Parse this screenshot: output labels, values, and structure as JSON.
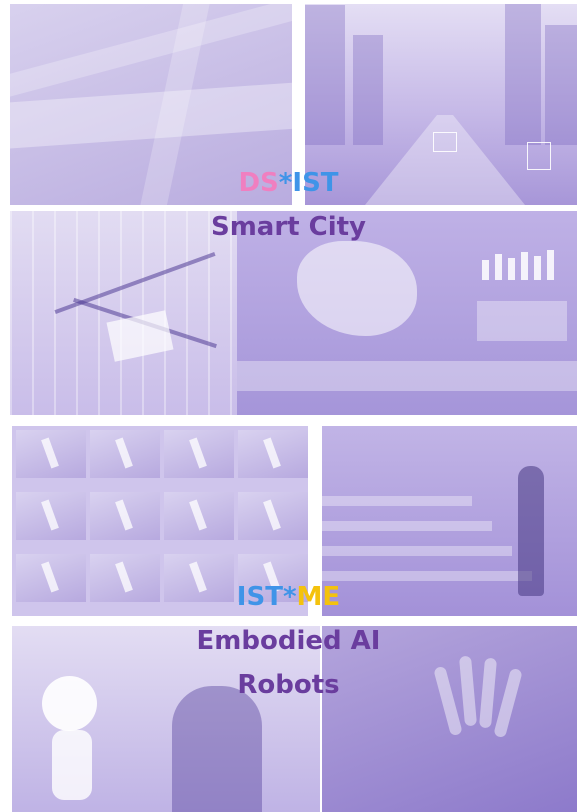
{
  "section1": {
    "tag_part1": "DS",
    "tag_sep": "*",
    "tag_part2": "IST",
    "title": "Smart City",
    "colors": {
      "part1": "#f07fc0",
      "part2": "#3f94e8",
      "title": "#6a3d9e"
    }
  },
  "section2": {
    "tag_part1": "IST",
    "tag_sep": "*",
    "tag_part2": "ME",
    "title_line1": "Embodied AI",
    "title_line2": "Robots",
    "colors": {
      "part1": "#3f94e8",
      "part2": "#f4c20d",
      "title": "#6a3d9e"
    }
  },
  "tint": "#b3a5de"
}
